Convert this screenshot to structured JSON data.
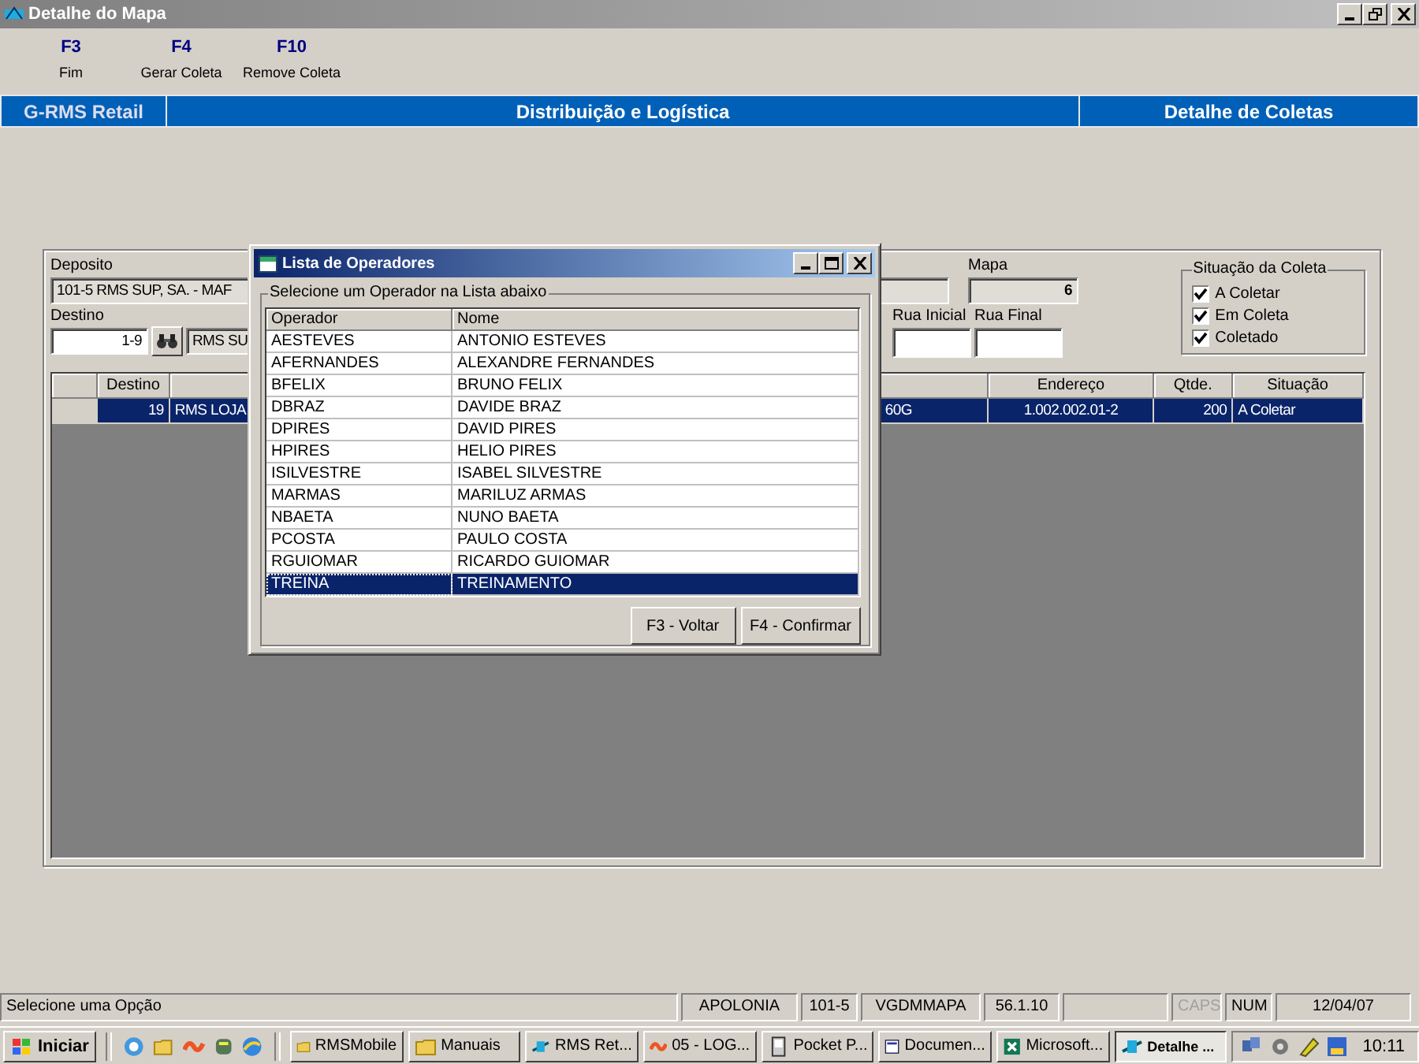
{
  "window": {
    "title": "Detalhe do Mapa"
  },
  "toolbar": [
    {
      "key": "F3",
      "label": "Fim"
    },
    {
      "key": "F4",
      "label": "Gerar Coleta"
    },
    {
      "key": "F10",
      "label": "Remove Coleta"
    }
  ],
  "banner": {
    "left": "G-RMS Retail",
    "center": "Distribuição e Logística",
    "right": "Detalhe de Coletas"
  },
  "form": {
    "deposito": {
      "label": "Deposito",
      "value": "101-5  RMS SUP, SA. - MAF"
    },
    "mapa": {
      "label": "Mapa",
      "value": "6"
    },
    "destino": {
      "label": "Destino",
      "code": "1-9",
      "name": "RMS SU"
    },
    "rua_inicial": {
      "label": "Rua Inicial"
    },
    "rua_final": {
      "label": "Rua Final"
    },
    "situacao": {
      "title": "Situação da Coleta",
      "options": [
        {
          "label": "A Coletar",
          "checked": true
        },
        {
          "label": "Em Coleta",
          "checked": true
        },
        {
          "label": "Coletado",
          "checked": true
        }
      ]
    },
    "grid": {
      "columns": {
        "destino": "Destino",
        "endereco": "Endereço",
        "qtde": "Qtde.",
        "situacao": "Situação"
      },
      "rows": [
        {
          "destino": "19",
          "column_3": "RMS LOJA",
          "column_4": "60G",
          "endereco": "1.002.002.01-2",
          "qtde": "200",
          "situacao": "A Coletar",
          "selected": true
        }
      ]
    }
  },
  "dialog": {
    "title": "Lista de Operadores",
    "group_label": "Selecione um Operador na Lista abaixo",
    "columns": [
      "Operador",
      "Nome"
    ],
    "rows": [
      {
        "operador": "AESTEVES",
        "nome": "ANTONIO ESTEVES",
        "selected": false
      },
      {
        "operador": "AFERNANDES",
        "nome": "ALEXANDRE FERNANDES",
        "selected": false
      },
      {
        "operador": "BFELIX",
        "nome": "BRUNO FELIX",
        "selected": false
      },
      {
        "operador": "DBRAZ",
        "nome": "DAVIDE BRAZ",
        "selected": false
      },
      {
        "operador": "DPIRES",
        "nome": "DAVID PIRES",
        "selected": false
      },
      {
        "operador": "HPIRES",
        "nome": "HELIO PIRES",
        "selected": false
      },
      {
        "operador": "ISILVESTRE",
        "nome": "ISABEL SILVESTRE",
        "selected": false
      },
      {
        "operador": "MARMAS",
        "nome": "MARILUZ ARMAS",
        "selected": false
      },
      {
        "operador": "NBAETA",
        "nome": "NUNO BAETA",
        "selected": false
      },
      {
        "operador": "PCOSTA",
        "nome": "PAULO COSTA",
        "selected": false
      },
      {
        "operador": "RGUIOMAR",
        "nome": "RICARDO GUIOMAR",
        "selected": false
      },
      {
        "operador": "TREINA",
        "nome": "TREINAMENTO",
        "selected": true
      }
    ],
    "buttons": [
      "F3 - Voltar",
      "F4 - Confirmar"
    ]
  },
  "status_bar": {
    "message": "Selecione uma Opção",
    "panels": [
      {
        "text": "APOLONIA",
        "disabled": false
      },
      {
        "text": "101-5",
        "disabled": false
      },
      {
        "text": "VGDMMAPA",
        "disabled": false
      },
      {
        "text": "56.1.10",
        "disabled": false
      },
      {
        "kind": "blank"
      },
      {
        "text": "CAPS",
        "disabled": true
      },
      {
        "text": "NUM",
        "disabled": false
      },
      {
        "text": "12/04/07",
        "disabled": false
      }
    ]
  },
  "taskbar": {
    "start": "Iniciar",
    "tasks": [
      {
        "label": "RMSMobile",
        "kind": "folder",
        "selected": false
      },
      {
        "label": "Manuais",
        "kind": "folder",
        "selected": false
      },
      {
        "label": "RMS Ret...",
        "kind": "app",
        "selected": false
      },
      {
        "label": "05 - LOG...",
        "kind": "wave",
        "selected": false
      },
      {
        "label": "Pocket P...",
        "kind": "device",
        "selected": false
      },
      {
        "label": "Documen...",
        "kind": "word",
        "selected": false
      },
      {
        "label": "Microsoft...",
        "kind": "excel",
        "selected": false
      },
      {
        "label": "Detalhe ...",
        "kind": "app",
        "selected": true
      }
    ],
    "clock": "10:11"
  }
}
